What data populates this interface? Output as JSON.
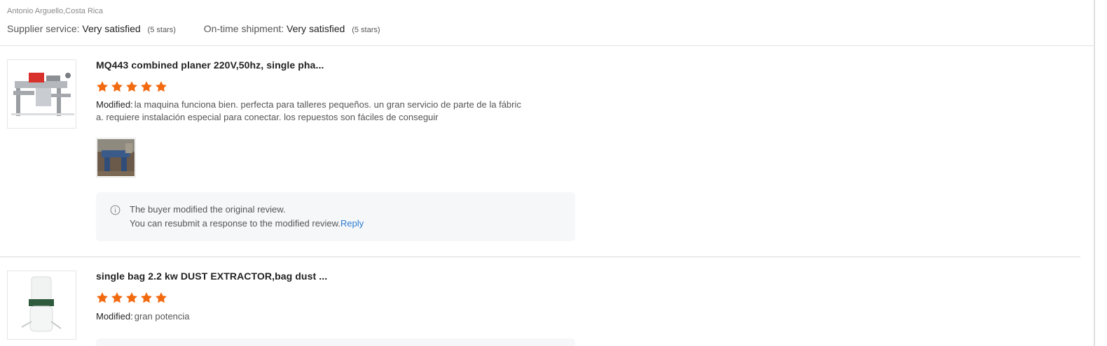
{
  "header": {
    "location": "Antonio Arguello,Costa Rica",
    "supplier_service": {
      "label": "Supplier service:",
      "value": "Very satisfied",
      "stars": "(5 stars)"
    },
    "on_time_shipment": {
      "label": "On-time shipment:",
      "value": "Very satisfied",
      "stars": "(5 stars)"
    }
  },
  "reviews": [
    {
      "title": "MQ443 combined planer 220V,50hz, single pha...",
      "rating": 5,
      "comment_label": "Modified:",
      "comment_line1": "la maquina funciona bien. perfecta para talleres pequeños. un gran servicio de parte de la fábric",
      "comment_line2": "a. requiere instalación especial para conectar. los repuestos son fáciles de conseguir",
      "notice_line1": "The buyer modified the original review.",
      "notice_line2": "You can resubmit a response to the modified review.",
      "reply_label": "Reply"
    },
    {
      "title": "single bag 2.2 kw DUST EXTRACTOR,bag dust ...",
      "rating": 5,
      "comment_label": "Modified:",
      "comment_line1": "gran potencia"
    }
  ],
  "colors": {
    "star": "#f26a10",
    "link": "#2b7bd0",
    "notice_bg": "#f6f7f9"
  },
  "icons": [
    "star-icon",
    "info-icon"
  ]
}
